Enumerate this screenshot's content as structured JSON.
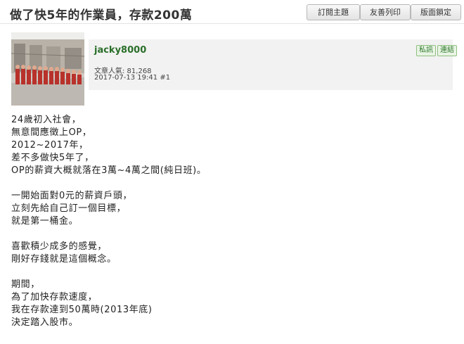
{
  "header": {
    "title": "做了快5年的作業員，存款200萬",
    "buttons": {
      "subscribe": "訂閱主題",
      "print": "友善列印",
      "lock": "版面鎖定"
    }
  },
  "post": {
    "username": "jacky8000",
    "popularity": "文章人氣: 81,268",
    "datetime": "2017-07-13 19:41",
    "floor": "#1",
    "actions": {
      "pm": "私訊",
      "link": "連結"
    },
    "paragraphs": [
      [
        "24歲初入社會，",
        "無意間應徵上OP，",
        "2012~2017年，",
        "差不多做快5年了，",
        "OP的薪資大概就落在3萬~4萬之間(純日班)。"
      ],
      [
        "一開始面對0元的薪資戶頭，",
        "立刻先給自己訂一個目標，",
        "就是第一桶金。"
      ],
      [
        "喜歡積少成多的感覺，",
        "剛好存錢就是這個概念。"
      ],
      [
        "期間，",
        "為了加快存款速度，",
        "我在存款達到50萬時(2013年底)",
        "決定踏入股市。"
      ]
    ]
  }
}
